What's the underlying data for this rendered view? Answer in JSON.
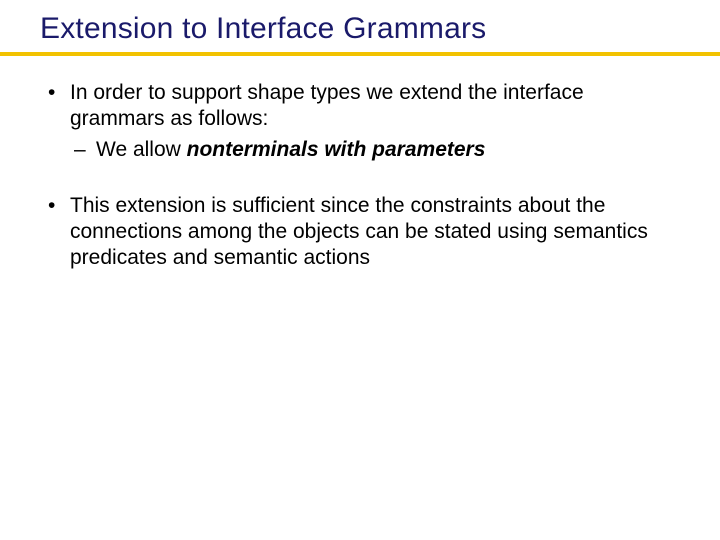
{
  "slide": {
    "title": "Extension to Interface Grammars",
    "bullets": [
      {
        "text": "In order to support shape types we extend the interface grammars as follows:",
        "children": [
          {
            "prefix": "We allow ",
            "emphasis": "nonterminals with parameters"
          }
        ]
      },
      {
        "text": "This extension is sufficient since the constraints about the connections among the objects can be stated using semantics predicates and semantic actions"
      }
    ]
  }
}
